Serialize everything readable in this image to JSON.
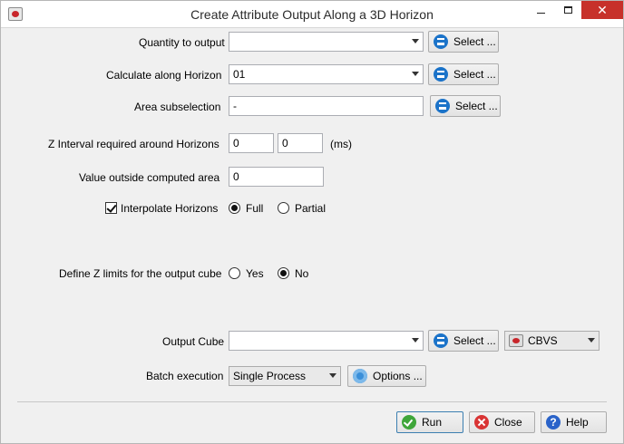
{
  "window": {
    "title": "Create Attribute Output Along a 3D Horizon"
  },
  "form": {
    "quantity_label": "Quantity to output",
    "quantity_value": "",
    "horizon_label": "Calculate along Horizon",
    "horizon_value": "01",
    "area_label": "Area subselection",
    "area_value": "-",
    "select_label": "Select ...",
    "zinterval_label": "Z Interval required around Horizons",
    "zinterval_values": [
      "0",
      "0"
    ],
    "zinterval_unit": "(ms)",
    "outside_label": "Value outside computed area",
    "outside_value": "0",
    "interpolate_label": "Interpolate Horizons",
    "interpolate_checked": true,
    "interp_options": [
      "Full",
      "Partial"
    ],
    "interp_selected": "Full",
    "zlimits_label": "Define Z limits for the output cube",
    "zlimits_options": [
      "Yes",
      "No"
    ],
    "zlimits_selected": "No",
    "output_label": "Output Cube",
    "output_value": "",
    "format_value": "CBVS",
    "batch_label": "Batch execution",
    "batch_value": "Single Process",
    "options_label": "Options ..."
  },
  "footer": {
    "run": "Run",
    "close": "Close",
    "help": "Help"
  },
  "icons": [
    "app-icon",
    "select-icon",
    "gear-icon",
    "run-icon",
    "close-icon",
    "help-icon",
    "cbvs-icon"
  ]
}
